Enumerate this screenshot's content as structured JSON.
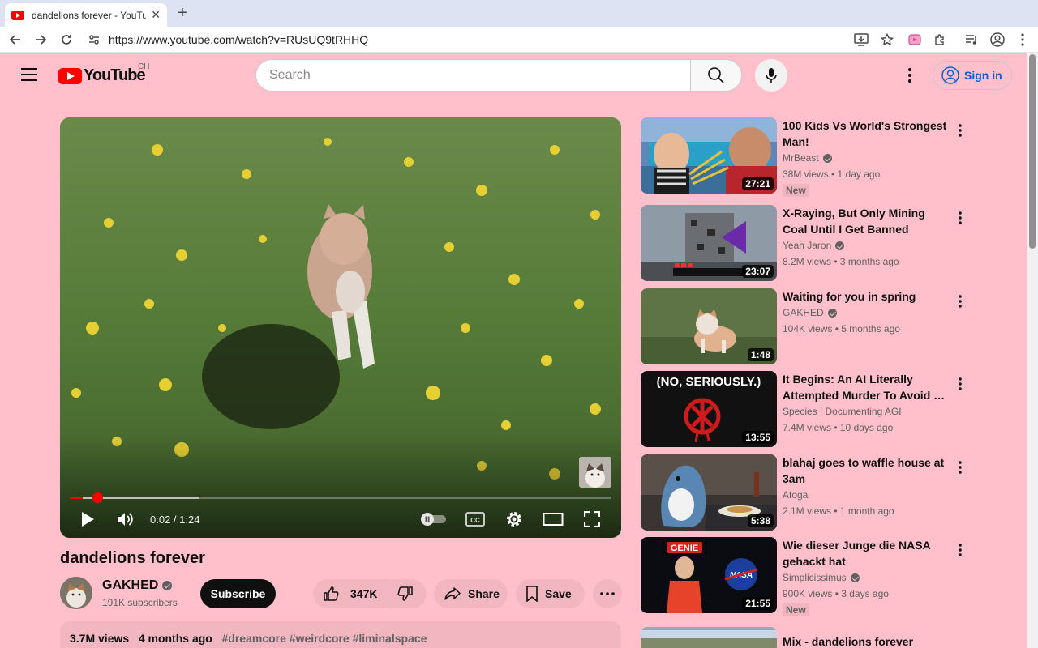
{
  "browser": {
    "tab_title": "dandelions forever - YouTube",
    "url": "https://www.youtube.com/watch?v=RUsUQ9tRHHQ"
  },
  "header": {
    "logo_text": "YouTube",
    "country_code": "CH",
    "search_placeholder": "Search",
    "signin_label": "Sign in"
  },
  "player": {
    "current_time": "0:02",
    "duration": "1:24",
    "time_display": "0:02 / 1:24",
    "played_fraction": 0.024,
    "loaded_fraction": 0.24
  },
  "video": {
    "title": "dandelions forever",
    "channel": "GAKHED",
    "subscribers": "191K subscribers",
    "subscribe_label": "Subscribe",
    "likes": "347K",
    "share_label": "Share",
    "save_label": "Save",
    "views": "3.7M views",
    "age": "4 months ago",
    "hashtags": "#dreamcore #weirdcore #liminalspace"
  },
  "recommendations": [
    {
      "title": "100 Kids Vs World's Strongest Man!",
      "channel": "MrBeast",
      "verified": true,
      "meta": "38M views • 1 day ago",
      "badge": "New",
      "duration": "27:21"
    },
    {
      "title": "X-Raying, But Only Mining Coal Until I Get Banned",
      "channel": "Yeah Jaron",
      "verified": true,
      "meta": "8.2M views • 3 months ago",
      "badge": "",
      "duration": "23:07"
    },
    {
      "title": "Waiting for you in spring",
      "channel": "GAKHED",
      "verified": true,
      "meta": "104K views • 5 months ago",
      "badge": "",
      "duration": "1:48"
    },
    {
      "title": "It Begins: An AI Literally Attempted Murder To Avoid …",
      "channel": "Species | Documenting AGI",
      "verified": false,
      "meta": "7.4M views • 10 days ago",
      "badge": "",
      "duration": "13:55"
    },
    {
      "title": "blahaj goes to waffle house at 3am",
      "channel": "Atoga",
      "verified": false,
      "meta": "2.1M views • 1 month ago",
      "badge": "",
      "duration": "5:38"
    },
    {
      "title": "Wie dieser Junge die NASA gehackt hat",
      "channel": "Simplicissimus",
      "verified": true,
      "meta": "900K views • 3 days ago",
      "badge": "New",
      "duration": "21:55"
    },
    {
      "title": "Mix - dandelions forever",
      "channel": "",
      "verified": false,
      "meta": "",
      "badge": "",
      "duration": ""
    }
  ],
  "thumb_texts": {
    "seriously": "(NO, SERIOUSLY.)",
    "genie": "GENIE",
    "nasa": "NASA"
  },
  "colors": {
    "page_bg": "#ffc0cb",
    "yt_red": "#ff0000",
    "signin_blue": "#065fd4"
  }
}
